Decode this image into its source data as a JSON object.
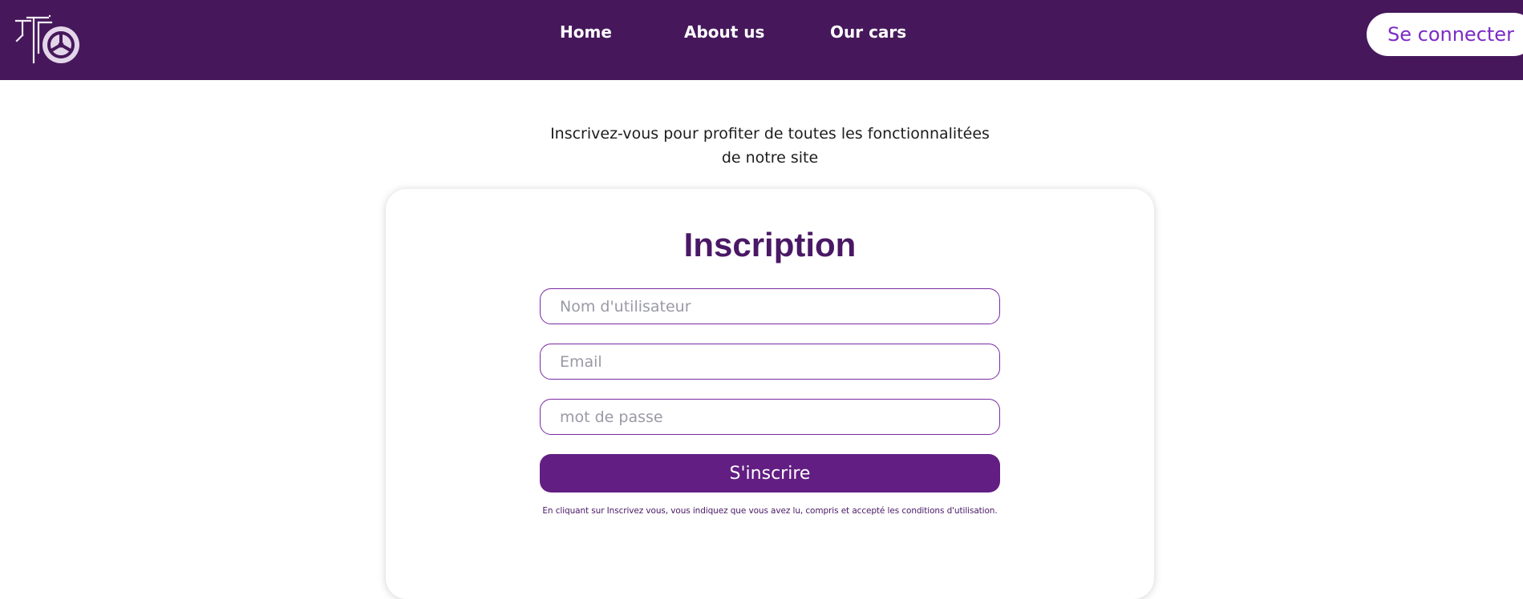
{
  "header": {
    "nav": [
      {
        "label": "Home"
      },
      {
        "label": "About us"
      },
      {
        "label": "Our cars"
      }
    ],
    "login_label": "Se connecter"
  },
  "intro": {
    "line1": "Inscrivez-vous pour profiter de toutes les fonctionnalitées",
    "line2": "de notre site"
  },
  "form": {
    "title": "Inscription",
    "username_placeholder": "Nom d'utilisateur",
    "email_placeholder": "Email",
    "password_placeholder": "mot de passe",
    "submit_label": "S'inscrire",
    "terms": "En cliquant sur Inscrivez vous, vous indiquez que vous avez lu, compris et accepté les conditions d'utilisation."
  },
  "colors": {
    "header_bg": "#46185b",
    "accent": "#621e82",
    "title": "#4a1865",
    "login_text": "#7b2bc6"
  },
  "icons": {
    "logo": "wheel-logo-icon"
  }
}
